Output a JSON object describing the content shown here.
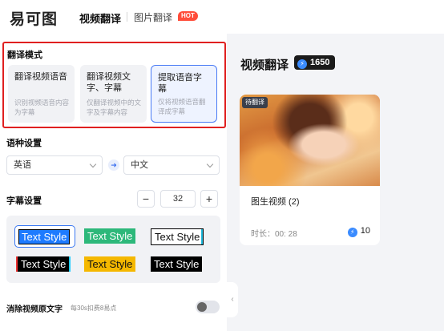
{
  "header": {
    "logo": "易可图",
    "nav_active": "视频翻译",
    "nav_item": "图片翻译",
    "hot_badge": "HOT"
  },
  "left": {
    "mode_title": "翻译模式",
    "modes": [
      {
        "title": "翻译视频语音",
        "desc": "识别视频语音内容为字幕"
      },
      {
        "title": "翻译视频文字、字幕",
        "desc": "仅翻译视频中的文字及字幕内容"
      },
      {
        "title": "提取语音字幕",
        "desc": "仅将视频语音翻译成字幕"
      }
    ],
    "lang_title": "语种设置",
    "source_lang": "英语",
    "target_lang": "中文",
    "subtitle_title": "字幕设置",
    "font_size": "32",
    "minus": "−",
    "plus": "+",
    "styles": [
      "Text Style",
      "Text Style",
      "Text Style",
      "Text Style",
      "Text Style",
      "Text Style"
    ],
    "erase_label": "消除视频原文字",
    "erase_note": "每30s扣费8易点",
    "collapse": "‹"
  },
  "right": {
    "title": "视频翻译",
    "credits": "1650",
    "card": {
      "tag": "待翻译",
      "name": "图生视频 (2)",
      "duration": "时长：00: 28",
      "credits": "10"
    }
  },
  "colors": {
    "accent": "#3a78f2",
    "highlight_border": "#e02020",
    "hot": "#ff4d3a"
  }
}
